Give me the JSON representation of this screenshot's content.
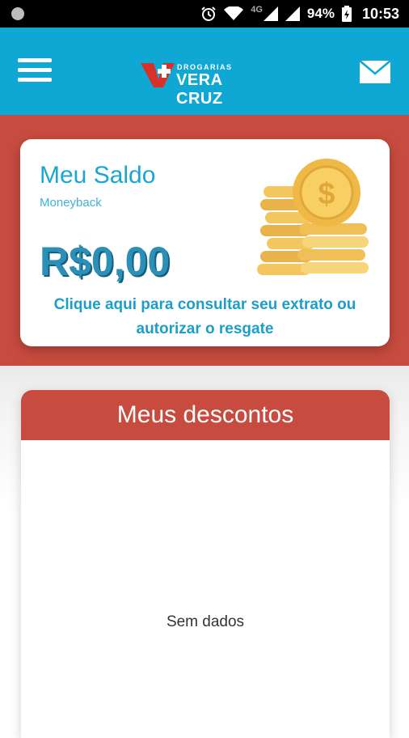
{
  "status_bar": {
    "network": "4G",
    "battery": "94%",
    "time": "10:53",
    "icons": [
      "notification-dot-icon",
      "alarm-icon",
      "wifi-icon",
      "signal-icon",
      "signal-icon",
      "battery-icon"
    ]
  },
  "app_bar": {
    "logo_small": "DROGARIAS",
    "logo_big": "VERA CRUZ",
    "menu_icon": "hamburger-menu-icon",
    "mail_icon": "envelope-icon",
    "color": "#0fa8d4"
  },
  "saldo_card": {
    "title": "Meu Saldo",
    "subtitle": "Moneyback",
    "value": "R$0,00",
    "link_line1": "Clique aqui para consultar seu extrato ou",
    "link_line2": "autorizar o resgate",
    "icon": "coins-icon"
  },
  "descontos": {
    "title": "Meus descontos",
    "empty_text": "Sem dados",
    "color": "#c84b3f"
  }
}
